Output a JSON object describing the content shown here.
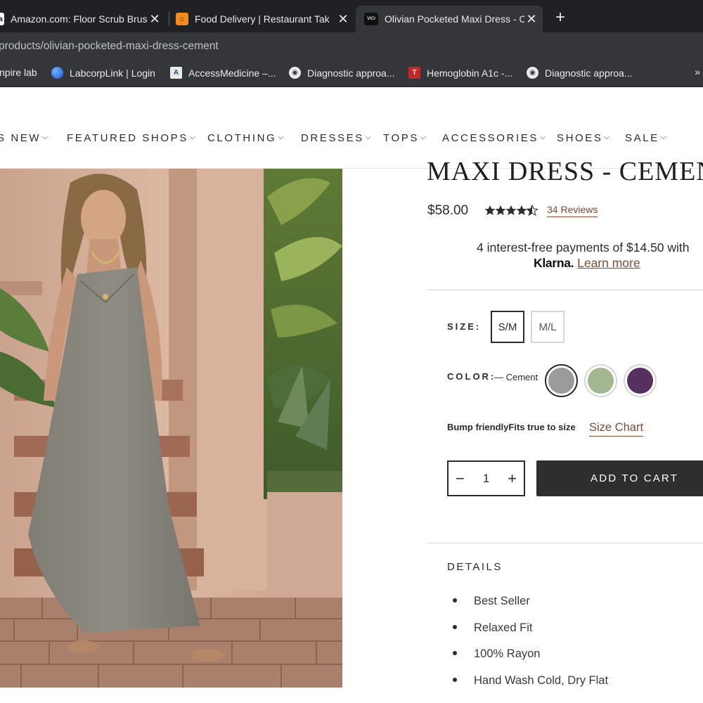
{
  "browser": {
    "tabs": [
      {
        "title": "Amazon.com: Floor Scrub Brus",
        "favicon": "amazon-favicon"
      },
      {
        "title": "Food Delivery | Restaurant Tak",
        "favicon": "doordash-favicon"
      },
      {
        "title": "Olivian Pocketed Maxi Dress - C",
        "favicon": "vici-favicon",
        "favicon_text": "VICI"
      }
    ],
    "new_tab_label": "+",
    "url": "products/olivian-pocketed-maxi-dress-cement",
    "bookmarks": [
      {
        "label": "npire lab"
      },
      {
        "label": "LabcorpLink | Login"
      },
      {
        "label": "AccessMedicine –..."
      },
      {
        "label": "Diagnostic approa..."
      },
      {
        "label": "Hemoglobin A1c -..."
      },
      {
        "label": "Diagnostic approa..."
      }
    ],
    "bookmarks_more": "»"
  },
  "nav": {
    "items": [
      "S NEW",
      "FEATURED SHOPS",
      "CLOTHING",
      "DRESSES",
      "TOPS",
      "ACCESSORIES",
      "SHOES",
      "SALE"
    ]
  },
  "product": {
    "title": "MAXI DRESS - CEMEN",
    "price": "$58.00",
    "rating": 4.5,
    "reviews_label": "34 Reviews",
    "klarna_line1": "4 interest-free payments of $14.50 with",
    "klarna_logo": "Klarna.",
    "klarna_link": "Learn more",
    "size_label": "SIZE:",
    "sizes": [
      {
        "label": "S/M",
        "selected": true
      },
      {
        "label": "M/L",
        "selected": false
      }
    ],
    "color_label": "COLOR:",
    "color_selected": "— Cement",
    "colors": [
      {
        "name": "cement",
        "hex": "#9a9b9b",
        "selected": true
      },
      {
        "name": "sage",
        "hex": "#a3b892",
        "selected": false
      },
      {
        "name": "plum",
        "hex": "#56305e",
        "selected": false
      }
    ],
    "fit_note": "Bump friendlyFits true to size",
    "size_chart_label": "Size Chart",
    "quantity": "1",
    "qty_minus": "−",
    "qty_plus": "+",
    "add_to_cart": "ADD TO CART",
    "details_heading": "DETAILS",
    "details": [
      "Best Seller",
      "Relaxed Fit",
      "100% Rayon",
      "Hand Wash Cold, Dry Flat"
    ]
  },
  "colors": {
    "accent_link": "#7a4c3c",
    "button_dark": "#2e2e2e",
    "chrome_dark": "#202124",
    "chrome_mid": "#35363a"
  }
}
